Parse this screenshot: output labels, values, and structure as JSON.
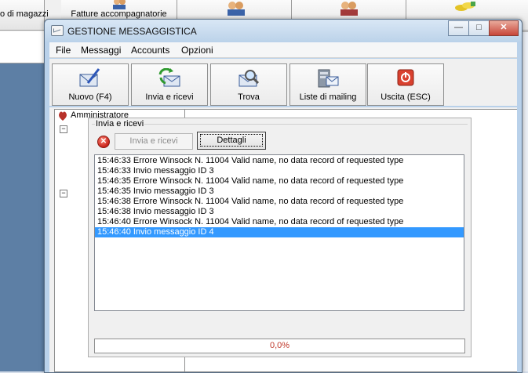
{
  "background_app": {
    "toolbar_left_label": "o di magazzi",
    "toolbar_button_label": "Fatture accompagnatorie"
  },
  "window": {
    "title": "GESTIONE MESSAGGISTICA",
    "controls": {
      "minimize": "—",
      "maximize": "□",
      "close": "✕"
    },
    "menu": [
      "File",
      "Messaggi",
      "Accounts",
      "Opzioni"
    ],
    "toolbar": [
      {
        "label": "Nuovo (F4)",
        "icon": "compose-mail-icon"
      },
      {
        "label": "Invia e ricevi",
        "icon": "send-receive-icon"
      },
      {
        "label": "Trova",
        "icon": "find-icon"
      },
      {
        "label": "Liste di mailing",
        "icon": "mailing-list-icon"
      },
      {
        "label": "Uscita (ESC)",
        "icon": "power-exit-icon"
      }
    ],
    "tree": {
      "root_label": "Amministratore"
    }
  },
  "dialog": {
    "title": "Invia e ricevi",
    "send_receive_button": "Invia e ricevi",
    "details_button": "Dettagli",
    "log": [
      "15:46:33 Errore Winsock N. 11004 Valid name, no data record of requested type",
      "15:46:33 Invio messaggio ID 3",
      "15:46:35 Errore Winsock N. 11004 Valid name, no data record of requested type",
      "15:46:35 Invio messaggio ID 3",
      "15:46:38 Errore Winsock N. 11004 Valid name, no data record of requested type",
      "15:46:38 Invio messaggio ID 3",
      "15:46:40 Errore Winsock N. 11004 Valid name, no data record of requested type",
      "15:46:40 Invio messaggio ID 4"
    ],
    "selected_log_index": 7,
    "progress_text": "0,0%",
    "progress_fraction": 0.0
  },
  "colors": {
    "selection": "#3399ff",
    "progress_text": "#c0392b",
    "exit_red": "#d9412f"
  }
}
